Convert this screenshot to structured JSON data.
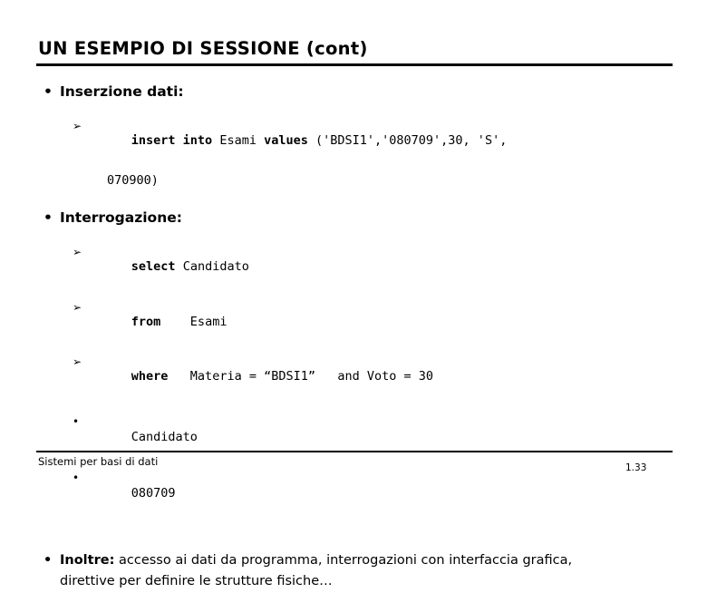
{
  "slide": {
    "title": "UN ESEMPIO DI SESSIONE (cont)",
    "bullet_glyph": "•",
    "arrow_glyph": "➢",
    "text_color": "#000000",
    "background_color": "#ffffff",
    "rule_color": "#000000"
  },
  "sections": {
    "insert": {
      "heading": "Inserzione dati:",
      "code_line_1": {
        "keyword_1": "insert into",
        "table": " Esami ",
        "keyword_2": "values",
        "tail": " ('BDSI1','080709',30, 'S',"
      },
      "code_line_2": "070900)"
    },
    "query": {
      "heading": "Interrogazione:",
      "lines": [
        {
          "keyword": "select",
          "rest": " Candidato"
        },
        {
          "keyword": "from",
          "rest": "    Esami"
        },
        {
          "keyword": "where",
          "rest": "   Materia = “BDSI1”   and Voto = 30"
        }
      ],
      "results": [
        "Candidato",
        "080709"
      ]
    },
    "note": {
      "lead": "Inoltre:",
      "text": " accesso ai dati da programma, interrogazioni con interfaccia grafica, direttive per definire le strutture fisiche…"
    }
  },
  "footer": {
    "course": "Sistemi per basi di dati",
    "page_number": "1.33"
  }
}
